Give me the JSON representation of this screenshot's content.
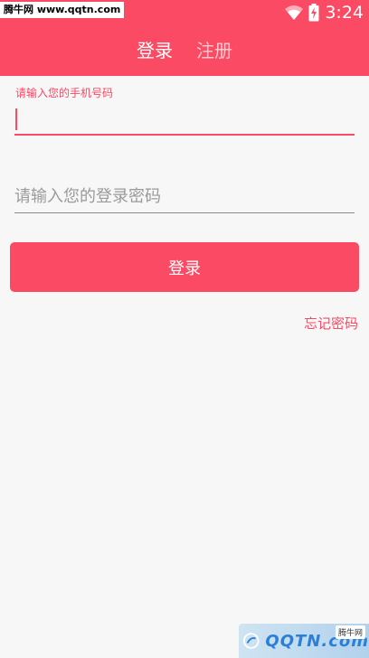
{
  "status_bar": {
    "watermark": "腾牛网 www.qqtn.com",
    "time": "3:24",
    "icons": [
      "wifi-icon",
      "battery-charging-icon"
    ]
  },
  "tabs": [
    {
      "label": "登录",
      "active": true
    },
    {
      "label": "注册",
      "active": false
    }
  ],
  "form": {
    "phone_label": "请输入您的手机号码",
    "phone_value": "",
    "password_placeholder": "请输入您的登录密码",
    "password_value": "",
    "login_button": "登录",
    "forgot_password": "忘记密码"
  },
  "watermark_bottom": {
    "text": "QQTN.com",
    "badge": "腾牛网"
  },
  "colors": {
    "accent": "#fb4a64",
    "background": "#f7f7f7"
  }
}
